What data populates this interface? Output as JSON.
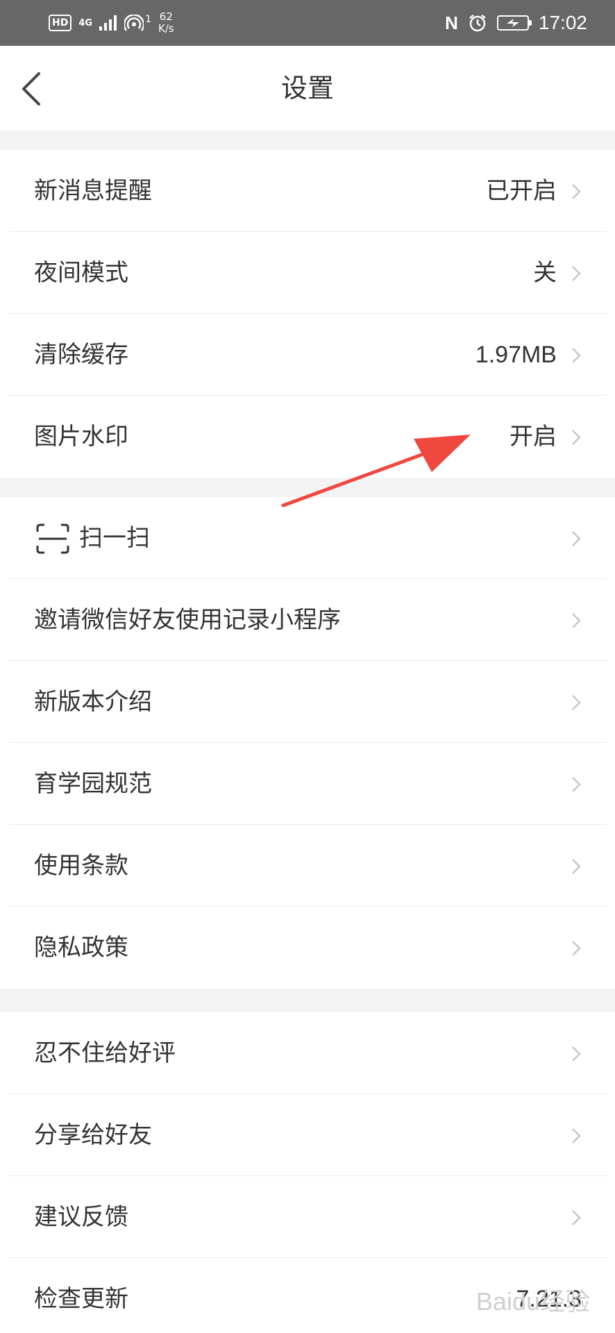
{
  "status_bar": {
    "hd": "HD",
    "network": "4G",
    "hotspot": "1",
    "speed_value": "62",
    "speed_unit": "K/s",
    "nfc": "N",
    "time": "17:02"
  },
  "header": {
    "title": "设置",
    "back_icon": "chevron-left-icon"
  },
  "group1": [
    {
      "label": "新消息提醒",
      "value": "已开启"
    },
    {
      "label": "夜间模式",
      "value": "关"
    },
    {
      "label": "清除缓存",
      "value": "1.97MB"
    },
    {
      "label": "图片水印",
      "value": "开启"
    }
  ],
  "group2": [
    {
      "label": "扫一扫",
      "icon": "scan-icon"
    },
    {
      "label": "邀请微信好友使用记录小程序"
    },
    {
      "label": "新版本介绍"
    },
    {
      "label": "育学园规范"
    },
    {
      "label": "使用条款"
    },
    {
      "label": "隐私政策"
    }
  ],
  "group3": [
    {
      "label": "忍不住给好评"
    },
    {
      "label": "分享给好友"
    },
    {
      "label": "建议反馈"
    },
    {
      "label": "检查更新",
      "value": "7.21.3"
    }
  ],
  "watermark_text": "Baidu经验",
  "colors": {
    "status_bar": "#676767",
    "background": "#f3f3f3",
    "annotation_arrow": "#f0473f",
    "chevron": "#c7c7c7"
  }
}
